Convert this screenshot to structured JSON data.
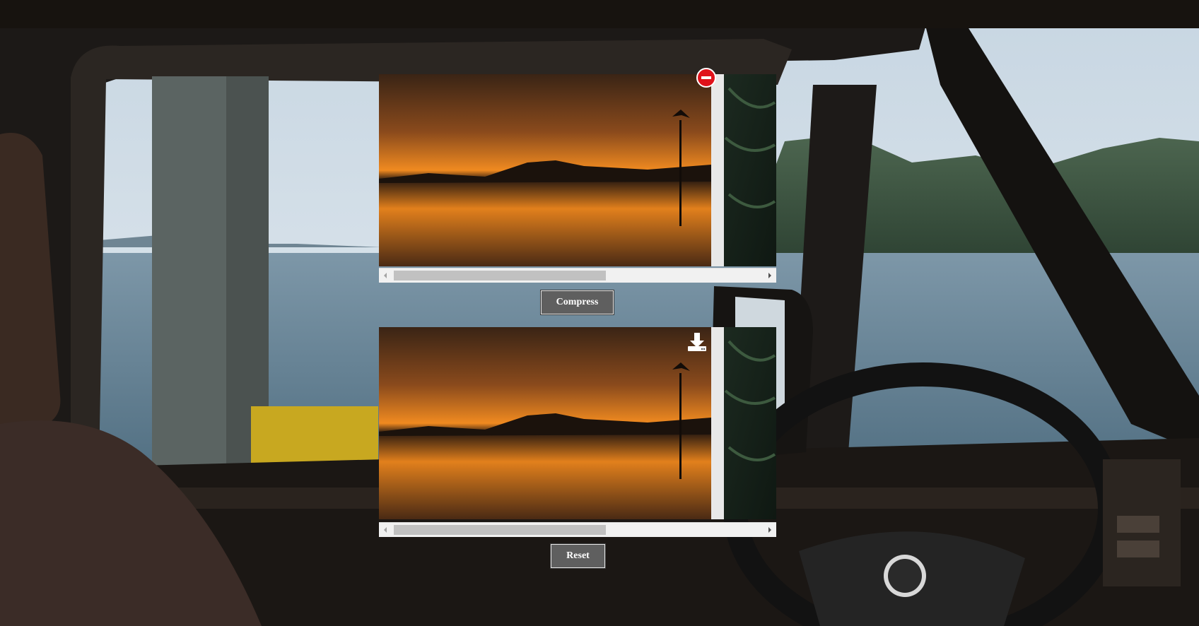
{
  "buttons": {
    "compress_label": "Compress",
    "reset_label": "Reset"
  },
  "icons": {
    "remove": "remove-icon",
    "download": "download-icon",
    "scroll_left": "chevron-left-icon",
    "scroll_right": "chevron-right-icon"
  },
  "colors": {
    "button_bg": "#5f5f5f",
    "remove_red": "#e0121b",
    "scrollbar_track": "#f1f1f1",
    "scrollbar_thumb": "#c1c1c1"
  }
}
